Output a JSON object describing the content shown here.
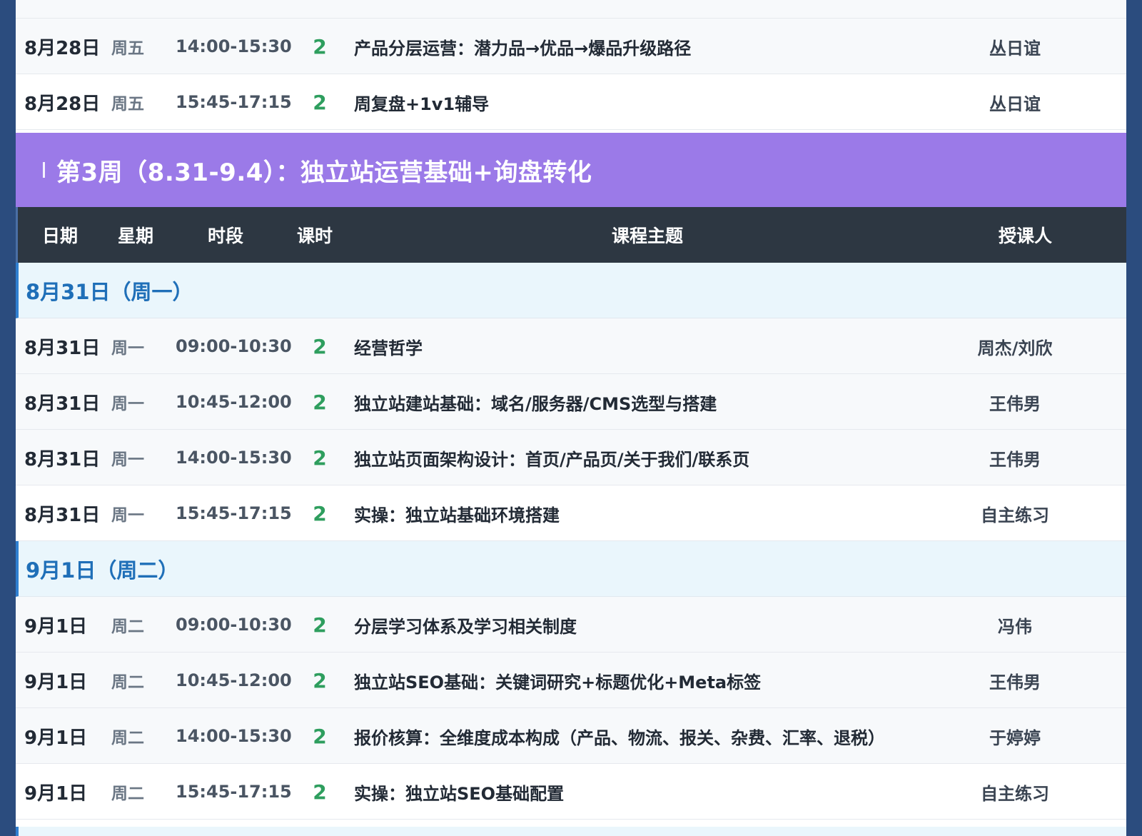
{
  "week3": {
    "banner": "第3周（8.31-9.4）：独立站运营基础+询盘转化"
  },
  "header": {
    "date": "日期",
    "weekday": "星期",
    "time": "时段",
    "hours": "课时",
    "topic": "课程主题",
    "teacher": "授课人"
  },
  "top_rows": [
    {
      "date": "8月28日",
      "weekday": "周五",
      "time": "14:00-15:30",
      "hours": "2",
      "topic": "产品分层运营：潜力品→优品→爆品升级路径",
      "teacher": "丛日谊"
    },
    {
      "date": "8月28日",
      "weekday": "周五",
      "time": "15:45-17:15",
      "hours": "2",
      "topic": "周复盘+1v1辅导",
      "teacher": "丛日谊"
    }
  ],
  "days": [
    {
      "title": "8月31日（周一）",
      "rows": [
        {
          "date": "8月31日",
          "weekday": "周一",
          "time": "09:00-10:30",
          "hours": "2",
          "topic": "经营哲学",
          "teacher": "周杰/刘欣"
        },
        {
          "date": "8月31日",
          "weekday": "周一",
          "time": "10:45-12:00",
          "hours": "2",
          "topic": "独立站建站基础：域名/服务器/CMS选型与搭建",
          "teacher": "王伟男"
        },
        {
          "date": "8月31日",
          "weekday": "周一",
          "time": "14:00-15:30",
          "hours": "2",
          "topic": "独立站页面架构设计：首页/产品页/关于我们/联系页",
          "teacher": "王伟男"
        },
        {
          "date": "8月31日",
          "weekday": "周一",
          "time": "15:45-17:15",
          "hours": "2",
          "topic": "实操：独立站基础环境搭建",
          "teacher": "自主练习"
        }
      ]
    },
    {
      "title": "9月1日（周二）",
      "rows": [
        {
          "date": "9月1日",
          "weekday": "周二",
          "time": "09:00-10:30",
          "hours": "2",
          "topic": "分层学习体系及学习相关制度",
          "teacher": "冯伟"
        },
        {
          "date": "9月1日",
          "weekday": "周二",
          "time": "10:45-12:00",
          "hours": "2",
          "topic": "独立站SEO基础：关键词研究+标题优化+Meta标签",
          "teacher": "王伟男"
        },
        {
          "date": "9月1日",
          "weekday": "周二",
          "time": "14:00-15:30",
          "hours": "2",
          "topic": "报价核算：全维度成本构成（产品、物流、报关、杂费、汇率、退税）",
          "teacher": "于婷婷"
        },
        {
          "date": "9月1日",
          "weekday": "周二",
          "time": "15:45-17:15",
          "hours": "2",
          "topic": "实操：独立站SEO基础配置",
          "teacher": "自主练习"
        }
      ]
    }
  ]
}
